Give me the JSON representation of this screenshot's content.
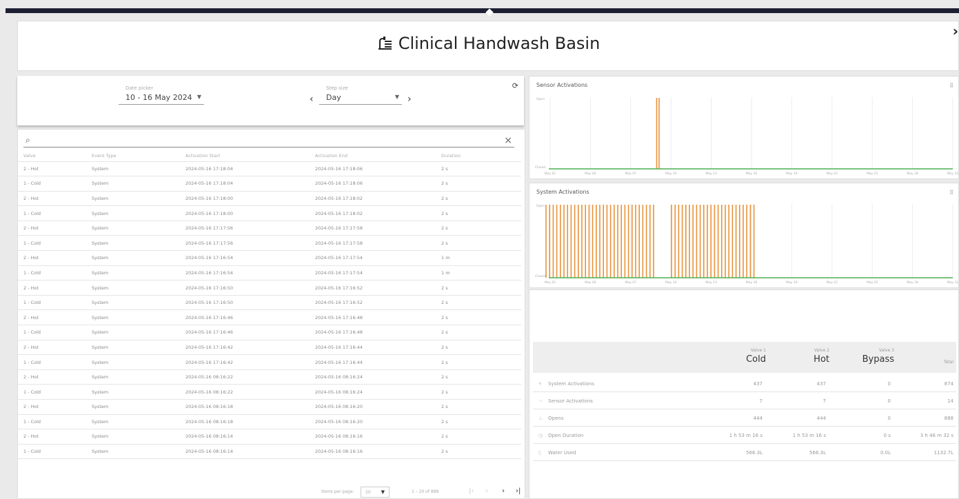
{
  "header": {
    "title": "Clinical Handwash Basin",
    "close": "›"
  },
  "filters": {
    "date_label": "Date picker",
    "date_value": "10 - 16 May 2024",
    "step_label": "Step size",
    "step_value": "Day"
  },
  "table": {
    "columns": [
      "Valve",
      "Event Type",
      "Activation Start",
      "Activation End",
      "Duration"
    ],
    "rows": [
      [
        "2 - Hot",
        "System",
        "2024-05-16 17:18:04",
        "2024-05-16 17:18:06",
        "2 s"
      ],
      [
        "1 - Cold",
        "System",
        "2024-05-16 17:18:04",
        "2024-05-16 17:18:06",
        "2 s"
      ],
      [
        "2 - Hot",
        "System",
        "2024-05-16 17:18:00",
        "2024-05-16 17:18:02",
        "2 s"
      ],
      [
        "1 - Cold",
        "System",
        "2024-05-16 17:18:00",
        "2024-05-16 17:18:02",
        "2 s"
      ],
      [
        "2 - Hot",
        "System",
        "2024-05-16 17:17:56",
        "2024-05-16 17:17:58",
        "2 s"
      ],
      [
        "1 - Cold",
        "System",
        "2024-05-16 17:17:56",
        "2024-05-16 17:17:58",
        "2 s"
      ],
      [
        "2 - Hot",
        "System",
        "2024-05-16 17:16:54",
        "2024-05-16 17:17:54",
        "1 m"
      ],
      [
        "1 - Cold",
        "System",
        "2024-05-16 17:16:54",
        "2024-05-16 17:17:54",
        "1 m"
      ],
      [
        "2 - Hot",
        "System",
        "2024-05-16 17:16:50",
        "2024-05-16 17:16:52",
        "2 s"
      ],
      [
        "1 - Cold",
        "System",
        "2024-05-16 17:16:50",
        "2024-05-16 17:16:52",
        "2 s"
      ],
      [
        "2 - Hot",
        "System",
        "2024-05-16 17:16:46",
        "2024-05-16 17:16:48",
        "2 s"
      ],
      [
        "1 - Cold",
        "System",
        "2024-05-16 17:16:46",
        "2024-05-16 17:16:48",
        "2 s"
      ],
      [
        "2 - Hot",
        "System",
        "2024-05-16 17:16:42",
        "2024-05-16 17:16:44",
        "2 s"
      ],
      [
        "1 - Cold",
        "System",
        "2024-05-16 17:16:42",
        "2024-05-16 17:16:44",
        "2 s"
      ],
      [
        "2 - Hot",
        "System",
        "2024-05-16 08:16:22",
        "2024-05-16 08:16:24",
        "2 s"
      ],
      [
        "1 - Cold",
        "System",
        "2024-05-16 08:16:22",
        "2024-05-16 08:16:24",
        "2 s"
      ],
      [
        "2 - Hot",
        "System",
        "2024-05-16 08:16:18",
        "2024-05-16 08:16:20",
        "2 s"
      ],
      [
        "1 - Cold",
        "System",
        "2024-05-16 08:16:18",
        "2024-05-16 08:16:20",
        "2 s"
      ],
      [
        "2 - Hot",
        "System",
        "2024-05-16 08:16:14",
        "2024-05-16 08:16:16",
        "2 s"
      ],
      [
        "1 - Cold",
        "System",
        "2024-05-16 08:16:14",
        "2024-05-16 08:16:16",
        "2 s"
      ]
    ]
  },
  "pagination": {
    "items_label": "Items per page:",
    "per_page": "20",
    "range": "1 – 20 of 888"
  },
  "charts": {
    "sensor_title": "Sensor Activations",
    "system_title": "System Activations",
    "y_top": "Open",
    "y_bottom": "Closed",
    "x_ticks": [
      "May 01",
      "May 04",
      "May 07",
      "May 10",
      "May 13",
      "May 16",
      "May 19",
      "May 22",
      "May 25",
      "May 28",
      "May 31"
    ],
    "colors": {
      "cold": "#e8923a",
      "hot": "#e8923a",
      "baseline": "#4caf50"
    }
  },
  "summary": {
    "valves": [
      {
        "small": "Valve 1",
        "name": "Cold"
      },
      {
        "small": "Valve 2",
        "name": "Hot"
      },
      {
        "small": "Valve 3",
        "name": "Bypass"
      }
    ],
    "total_label": "Total",
    "rows": [
      {
        "icon": "lightning-icon",
        "label": "System Activations",
        "cold": "437",
        "hot": "437",
        "bypass": "0",
        "total": "874"
      },
      {
        "icon": "hand-icon",
        "label": "Sensor Activations",
        "cold": "7",
        "hot": "7",
        "bypass": "0",
        "total": "14"
      },
      {
        "icon": "tap-icon",
        "label": "Opens",
        "cold": "444",
        "hot": "444",
        "bypass": "0",
        "total": "888"
      },
      {
        "icon": "timer-icon",
        "label": "Open Duration",
        "cold": "1 h 53 m 16 s",
        "hot": "1 h 53 m 16 s",
        "bypass": "0 s",
        "total": "3 h 46 m 32 s"
      },
      {
        "icon": "drop-icon",
        "label": "Water Used",
        "cold": "566.3L",
        "hot": "566.3L",
        "bypass": "0.0L",
        "total": "1132.7L"
      }
    ]
  }
}
